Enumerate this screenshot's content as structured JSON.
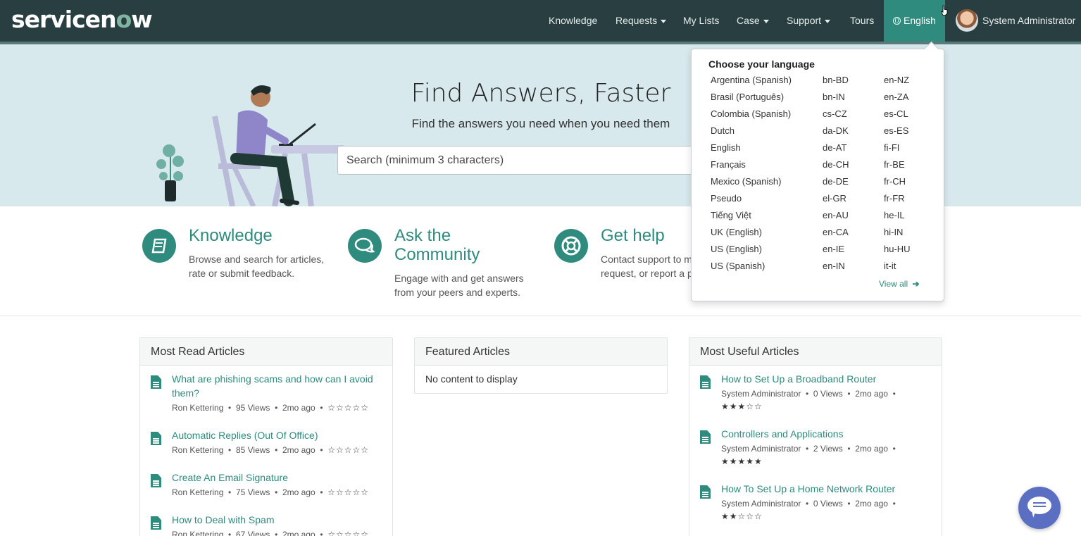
{
  "header": {
    "logo_text": "servicenow",
    "nav": [
      {
        "label": "Knowledge",
        "caret": false
      },
      {
        "label": "Requests",
        "caret": true
      },
      {
        "label": "My Lists",
        "caret": false
      },
      {
        "label": "Case",
        "caret": true
      },
      {
        "label": "Support",
        "caret": true
      },
      {
        "label": "Tours",
        "caret": false
      }
    ],
    "language_label": "English",
    "user_name": "System Administrator"
  },
  "hero": {
    "title": "Find Answers, Faster",
    "subtitle": "Find the answers you need when you need them",
    "search_placeholder": "Search (minimum 3 characters)"
  },
  "quick_links": [
    {
      "icon": "book-icon",
      "title": "Knowledge",
      "desc_lines": [
        "Browse and search for articles,",
        "rate or submit feedback."
      ]
    },
    {
      "icon": "chat-icon",
      "title_lines": [
        "Ask the",
        "Community"
      ],
      "desc_lines": [
        "Engage with and get answers",
        "from your peers and experts."
      ]
    },
    {
      "icon": "lifebuoy-icon",
      "title": "Get help",
      "desc_lines": [
        "Contact support to ma",
        "request, or report a pr"
      ]
    }
  ],
  "panels": {
    "most_read": {
      "title": "Most Read Articles",
      "articles": [
        {
          "title_lines": [
            "What are phishing scams and how can I avoid",
            "them?"
          ],
          "author": "Ron Kettering",
          "views": "95 Views",
          "age": "2mo ago",
          "stars": "☆☆☆☆☆"
        },
        {
          "title_lines": [
            "Automatic Replies (Out Of Office)"
          ],
          "author": "Ron Kettering",
          "views": "85 Views",
          "age": "2mo ago",
          "stars": "☆☆☆☆☆"
        },
        {
          "title_lines": [
            "Create An Email Signature"
          ],
          "author": "Ron Kettering",
          "views": "75 Views",
          "age": "2mo ago",
          "stars": "☆☆☆☆☆"
        },
        {
          "title_lines": [
            "How to Deal with Spam"
          ],
          "author": "Ron Kettering",
          "views": "67 Views",
          "age": "2mo ago",
          "stars": "☆☆☆☆☆"
        }
      ]
    },
    "featured": {
      "title": "Featured Articles",
      "empty_text": "No content to display"
    },
    "most_useful": {
      "title": "Most Useful Articles",
      "articles": [
        {
          "title_lines": [
            "How to Set Up a Broadband Router"
          ],
          "author": "System Administrator",
          "views": "0 Views",
          "age": "2mo ago",
          "stars": "★★★☆☆"
        },
        {
          "title_lines": [
            "Controllers and Applications"
          ],
          "author": "System Administrator",
          "views": "2 Views",
          "age": "2mo ago",
          "stars": "★★★★★"
        },
        {
          "title_lines": [
            "How To Set Up a Home Network Router"
          ],
          "author": "System Administrator",
          "views": "0 Views",
          "age": "2mo ago",
          "stars": "★★☆☆☆"
        }
      ]
    }
  },
  "language_menu": {
    "heading": "Choose your language",
    "col1": [
      "Argentina (Spanish)",
      "Brasil (Português)",
      "Colombia (Spanish)",
      "Dutch",
      "English",
      "Français",
      "Mexico (Spanish)",
      "Pseudo",
      "Tiếng Việt",
      "UK (English)",
      "US (English)",
      "US (Spanish)"
    ],
    "col2": [
      "bn-BD",
      "bn-IN",
      "cs-CZ",
      "da-DK",
      "de-AT",
      "de-CH",
      "de-DE",
      "el-GR",
      "en-AU",
      "en-CA",
      "en-IE",
      "en-IN"
    ],
    "col3": [
      "en-NZ",
      "en-ZA",
      "es-CL",
      "es-ES",
      "fi-FI",
      "fr-BE",
      "fr-CH",
      "fr-FR",
      "he-IL",
      "hi-IN",
      "hu-HU",
      "it-it"
    ],
    "view_all": "View all"
  },
  "colors": {
    "header_bg": "#293e40",
    "accent": "#2e8b7d",
    "hero_bg": "#d8e9ee",
    "chat_button": "#5b6fc2"
  }
}
